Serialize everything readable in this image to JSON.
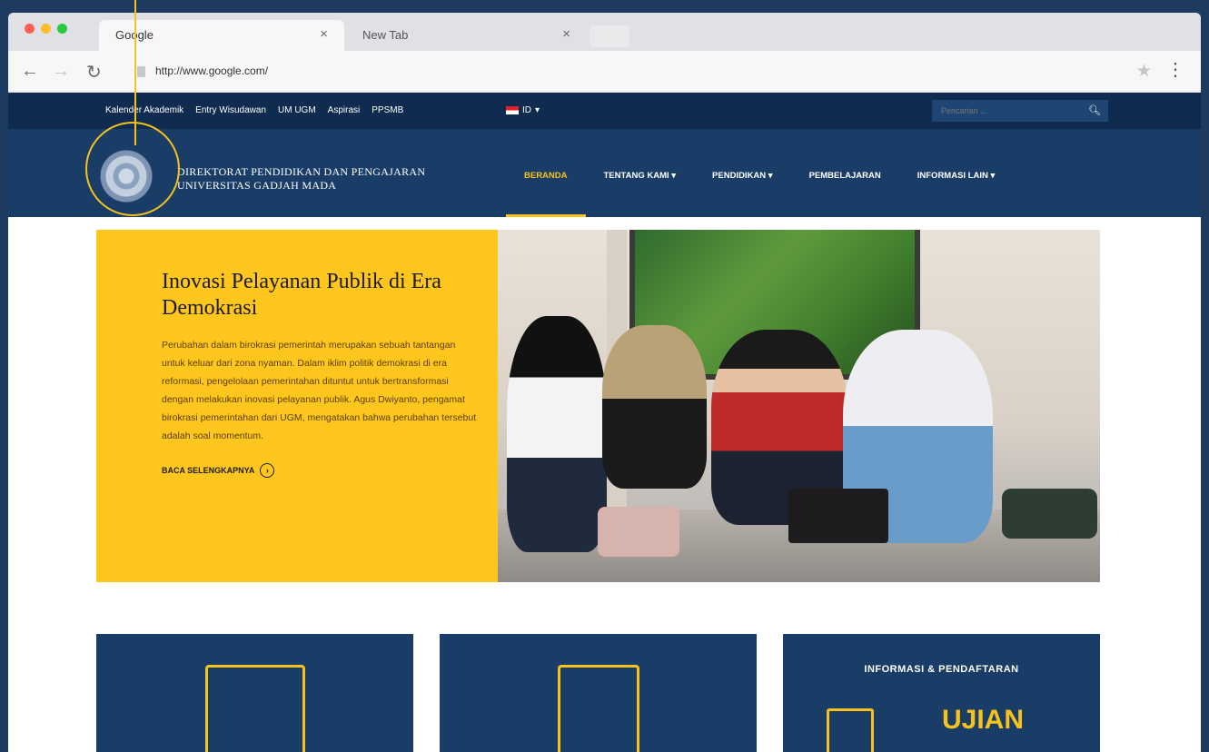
{
  "browser": {
    "tabs": [
      {
        "label": "Google",
        "active": true
      },
      {
        "label": "New Tab",
        "active": false
      }
    ],
    "close_glyph": "×",
    "url": "http://www.google.com/",
    "traffic_lights": [
      "#ff5f57",
      "#ffbd2e",
      "#28c940"
    ]
  },
  "site": {
    "top_links": [
      "Kalender Akademik",
      "Entry Wisudawan",
      "UM UGM",
      "Aspirasi",
      "PPSMB"
    ],
    "language": "ID",
    "search_placeholder": "Pencarian ...",
    "brand_line1": "DIREKTORAT PENDIDIKAN DAN PENGAJARAN",
    "brand_line2": "UNIVERSITAS GADJAH MADA",
    "menu": [
      {
        "label": "BERANDA",
        "active": true
      },
      {
        "label": "TENTANG KAMI ▾",
        "active": false
      },
      {
        "label": "PENDIDIKAN ▾",
        "active": false
      },
      {
        "label": "PEMBELAJARAN",
        "active": false
      },
      {
        "label": "INFORMASI LAIN ▾",
        "active": false
      }
    ],
    "hero": {
      "title": "Inovasi Pelayanan Publik di Era Demokrasi",
      "body": "Perubahan dalam birokrasi pemerintah merupakan sebuah tantangan untuk keluar dari zona nyaman. Dalam iklim politik demokrasi di era reformasi, pengelolaan pemerintahan dituntut untuk bertransformasi dengan melakukan inovasi pelayanan publik. Agus Dwiyanto, pengamat birokrasi pemerintahan dari UGM, mengatakan bahwa perubahan tersebut adalah soal momentum.",
      "read_more": "BACA SELENGKAPNYA"
    },
    "cards": [
      {
        "title": "",
        "big": ""
      },
      {
        "title": "",
        "big": ""
      },
      {
        "title": "INFORMASI & PENDAFTARAN",
        "big": "UJIAN"
      }
    ],
    "colors": {
      "navy": "#1a3d67",
      "gold": "#f6c21b",
      "hero_yellow": "#ffc71e"
    }
  }
}
